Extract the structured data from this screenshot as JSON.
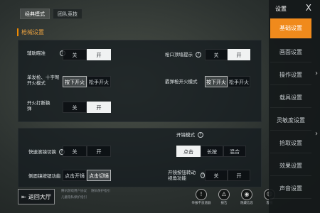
{
  "tabs": [
    {
      "label": "经典模式"
    },
    {
      "label": "团队竞技"
    }
  ],
  "section_title": "枪械设置",
  "panel1": {
    "assist_aim": {
      "label": "辅助瞄准",
      "off": "关",
      "on": "开"
    },
    "muzzle_hint": {
      "label": "枪口顶墙提示",
      "off": "关",
      "on": "开"
    },
    "single_fire": {
      "label": "单发枪、十字弩开火模式",
      "opt1": "按下开火",
      "opt2": "松手开火"
    },
    "shotgun_fire": {
      "label": "霰弹枪开火模式",
      "opt1": "按下开火",
      "opt2": "松手开火"
    },
    "fire_interrupt": {
      "label": "开火打断换弹",
      "off": "关",
      "on": "开"
    }
  },
  "panel2": {
    "scope_mode": {
      "label": "开镜模式",
      "opt1": "点击",
      "opt2": "长按",
      "opt3": "混合"
    },
    "quick_switch": {
      "label": "快速滚镜切换",
      "off": "关",
      "on": "开"
    },
    "side_scope": {
      "label": "侧面镜按钮功能",
      "opt1": "点击开镜",
      "opt2": "点击切镜"
    },
    "scope_turn": {
      "label": "开镜按钮转动视角功能",
      "off": "关",
      "on": "开"
    }
  },
  "sidebar": {
    "title": "设置",
    "close": "X",
    "items": [
      {
        "label": "基础设置"
      },
      {
        "label": "画面设置"
      },
      {
        "label": "操作设置"
      },
      {
        "label": "载具设置"
      },
      {
        "label": "灵敏度设置"
      },
      {
        "label": "拾取设置"
      },
      {
        "label": "效果设置"
      },
      {
        "label": "声音设置"
      }
    ]
  },
  "return_button": "返回大厅",
  "footer_links": [
    "腾讯游戏用户协议",
    "儿童隐私保护指引",
    "隐私保护指引"
  ],
  "bottom_icons": [
    {
      "label": "举报不良道器",
      "icon": "!"
    },
    {
      "label": "报告",
      "icon": "⚠"
    },
    {
      "label": "隐藏信息",
      "icon": "◉"
    },
    {
      "label": "客服",
      "icon": "☺"
    }
  ],
  "colors": {
    "accent": "#f08a1c",
    "section": "#e8a040"
  }
}
